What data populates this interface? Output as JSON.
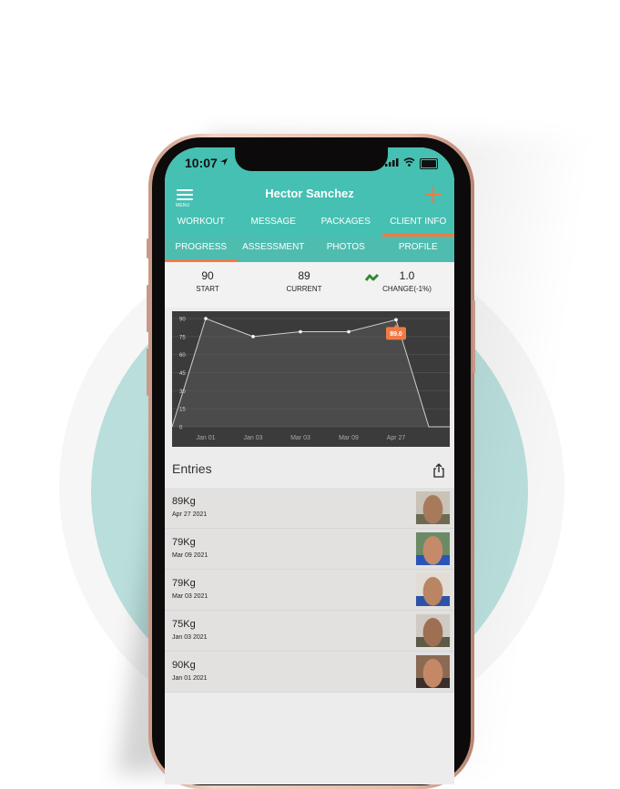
{
  "status_bar": {
    "time": "10:07"
  },
  "header": {
    "menu_label": "MENU",
    "title": "Hector Sanchez"
  },
  "tabs": [
    {
      "label": "WORKOUT",
      "active": false
    },
    {
      "label": "MESSAGE",
      "active": false
    },
    {
      "label": "PACKAGES",
      "active": false
    },
    {
      "label": "CLIENT INFO",
      "active": true
    }
  ],
  "subtabs": [
    {
      "label": "PROGRESS",
      "active": true
    },
    {
      "label": "ASSESSMENT",
      "active": false
    },
    {
      "label": "PHOTOS",
      "active": false
    },
    {
      "label": "PROFILE",
      "active": false
    }
  ],
  "stats": {
    "start": {
      "value": "90",
      "label": "START"
    },
    "current": {
      "value": "89",
      "label": "CURRENT"
    },
    "change": {
      "value": "1.0",
      "label": "CHANGE(-1%)"
    }
  },
  "colors": {
    "accent": "#f07a45",
    "teal": "#45c0b2",
    "trend": "#2e8b2e"
  },
  "chart_data": {
    "type": "area",
    "categories": [
      "Jan 01",
      "Jan 03",
      "Mar 03",
      "Mar 09",
      "Apr 27"
    ],
    "values": [
      90,
      75,
      79,
      79,
      89
    ],
    "yticks": [
      0,
      15,
      30,
      45,
      60,
      75,
      90
    ],
    "ylim": [
      0,
      90
    ],
    "tooltip": "89.0",
    "grid": true
  },
  "entries": {
    "title": "Entries",
    "items": [
      {
        "weight": "89Kg",
        "date": "Apr 27 2021"
      },
      {
        "weight": "79Kg",
        "date": "Mar 09 2021"
      },
      {
        "weight": "79Kg",
        "date": "Mar 03 2021"
      },
      {
        "weight": "75Kg",
        "date": "Jan 03 2021"
      },
      {
        "weight": "90Kg",
        "date": "Jan 01 2021"
      }
    ]
  }
}
